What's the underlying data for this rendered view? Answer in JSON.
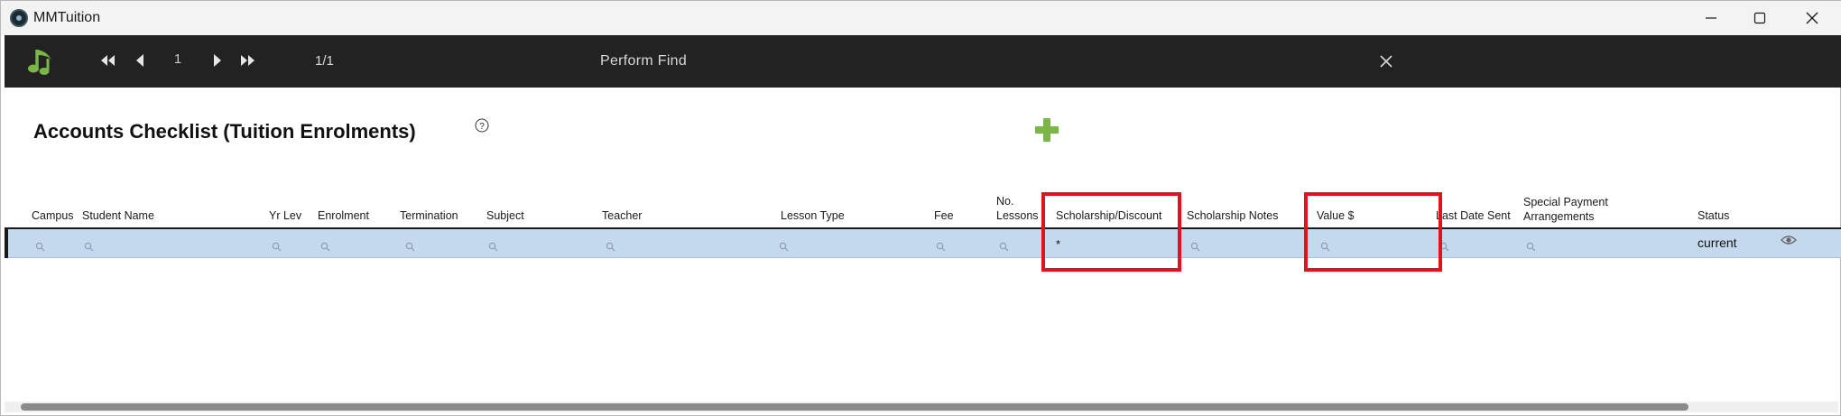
{
  "window": {
    "title": "MMTuition"
  },
  "toolbar": {
    "record_number": "1",
    "record_count": "1/1",
    "mode_label": "Perform Find"
  },
  "page": {
    "title": "Accounts Checklist (Tuition Enrolments)"
  },
  "table": {
    "columns": [
      {
        "label": "Campus"
      },
      {
        "label": "Student Name"
      },
      {
        "label": "Yr Lev"
      },
      {
        "label": "Enrolment"
      },
      {
        "label": "Termination"
      },
      {
        "label": "Subject"
      },
      {
        "label": "Teacher"
      },
      {
        "label": "Lesson Type"
      },
      {
        "label": "Fee"
      },
      {
        "label": "No.\nLessons"
      },
      {
        "label": "Scholarship/Discount"
      },
      {
        "label": "Scholarship Notes"
      },
      {
        "label": "Value $"
      },
      {
        "label": "Last Date Sent"
      },
      {
        "label": "Special Payment\nArrangements"
      },
      {
        "label": "Status"
      }
    ],
    "find_request": {
      "scholarship_discount": "*",
      "status": "current"
    }
  },
  "colors": {
    "toolbar_bg": "#222222",
    "accent_green": "#7ab648",
    "find_row_bg": "#c5d9ee",
    "highlight": "#e0121c"
  },
  "icons": {
    "logo": "music-note-icon",
    "first": "first-record-icon",
    "prev": "previous-record-icon",
    "next": "next-record-icon",
    "last": "last-record-icon",
    "close": "close-icon",
    "help": "help-icon",
    "add": "add-icon",
    "search": "search-icon",
    "view": "eye-icon"
  }
}
